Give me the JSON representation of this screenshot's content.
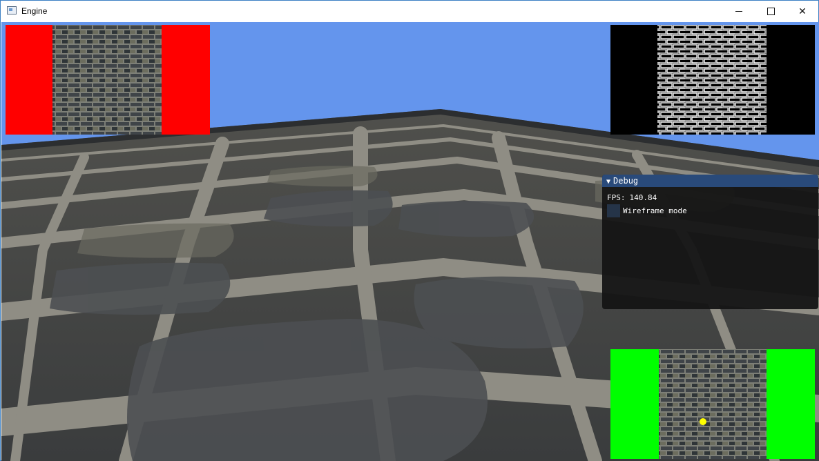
{
  "window": {
    "title": "Engine",
    "minimize_glyph": "—",
    "close_glyph": "✕"
  },
  "debug": {
    "title": "Debug",
    "collapse_glyph": "▼",
    "fps_label": "FPS:",
    "fps_value": "140.84",
    "checkbox_label": "Wireframe mode",
    "wireframe_checked": false
  },
  "colors": {
    "sky": "#6495ed",
    "panel_tl_bg": "#ff0000",
    "panel_tr_bg": "#000000",
    "panel_br_bg": "#00ff00",
    "marker": "#ffff00",
    "debug_header": "#294a7a"
  },
  "icons": [
    "app-window-icon",
    "minimize-icon",
    "maximize-icon",
    "close-icon",
    "collapse-triangle-icon"
  ]
}
